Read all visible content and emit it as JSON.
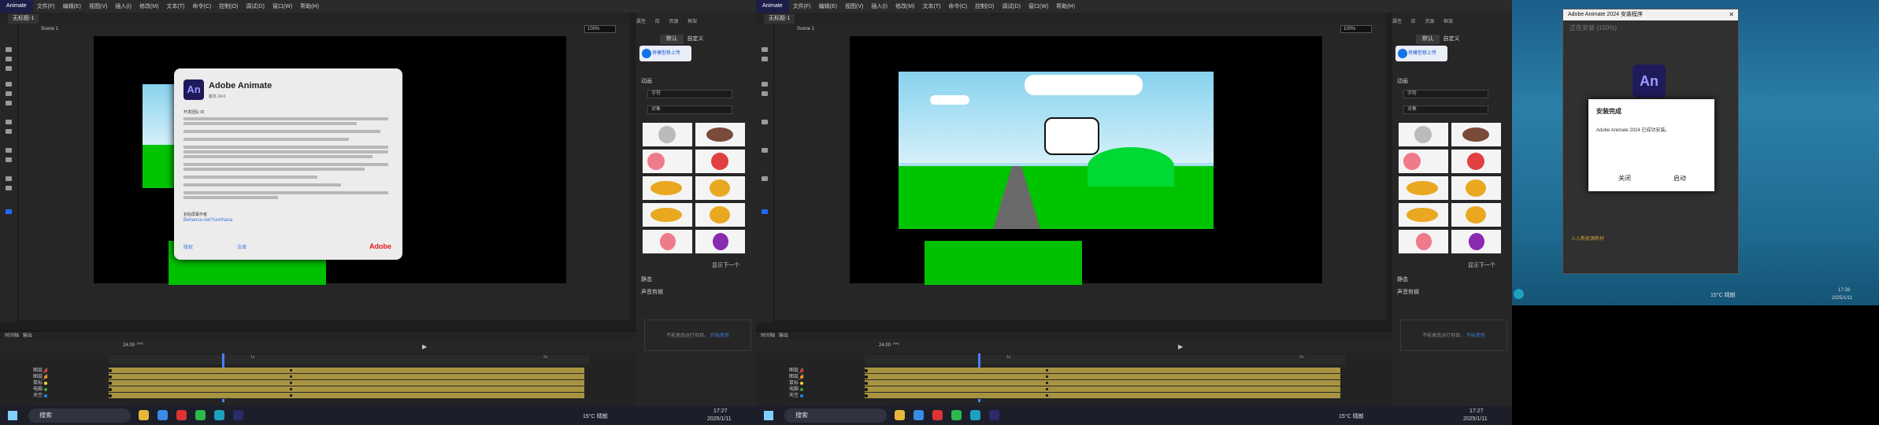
{
  "app": {
    "logo": "Animate",
    "menu": [
      "文件(F)",
      "编辑(E)",
      "视图(V)",
      "插入(I)",
      "修改(M)",
      "文本(T)",
      "命令(C)",
      "控制(O)",
      "调试(D)",
      "窗口(W)",
      "帮助(H)"
    ],
    "doc_tab": "无标题-1",
    "scene": "Scene 1",
    "zoom": "100%",
    "panel_tabs": [
      "属性",
      "库",
      "资源",
      "框架"
    ],
    "panel_tabs2": [
      "默认",
      "自定义"
    ],
    "cloud_button": "将模型移上传",
    "section_anim": "动画",
    "filter_dd": "字符",
    "type_dd": "对象",
    "more": "显示下一个",
    "section_static": "静态",
    "section_sound": "声音剪辑",
    "empty_hint": "不能更改运行项目。",
    "empty_link": "开始使用",
    "timeline_tabs": [
      "时间轴",
      "输出"
    ],
    "fps_label": "24.00",
    "fps_unit": "FPS",
    "ruler_marks": [
      "1s",
      "2s"
    ],
    "layers": [
      {
        "name": "图层_1",
        "color": "#e53935"
      },
      {
        "name": "图层_2",
        "color": "#ff9800"
      },
      {
        "name": "鼠标",
        "color": "#fdd835"
      },
      {
        "name": "电脑",
        "color": "#43a047"
      },
      {
        "name": "天空",
        "color": "#1e88e5"
      }
    ]
  },
  "about": {
    "title": "Adobe Animate",
    "version": "版本 24.0",
    "label1": "开发团队 ID",
    "credits_label": "初始屏幕作者",
    "link_a": "Behance.net/Yumihana",
    "link_b": "版权",
    "link_c": "法律",
    "brand": "Adobe"
  },
  "taskbar": {
    "search": "搜索",
    "weather": "15°C 晴朗",
    "time": "17:27",
    "date": "2025/1/11"
  },
  "installer": {
    "window_title": "Adobe Animate 2024 安装程序",
    "bg_heading": "正在安装 (100%)",
    "bg_hint": "入入新能源新材",
    "modal_title": "安装完成",
    "modal_text": "Adobe Animate 2024 已成功安装。",
    "close_btn": "关闭",
    "launch_btn": "启动",
    "weather": "15°C 晴朗",
    "time": "17:28",
    "date": "2025/1/11"
  }
}
